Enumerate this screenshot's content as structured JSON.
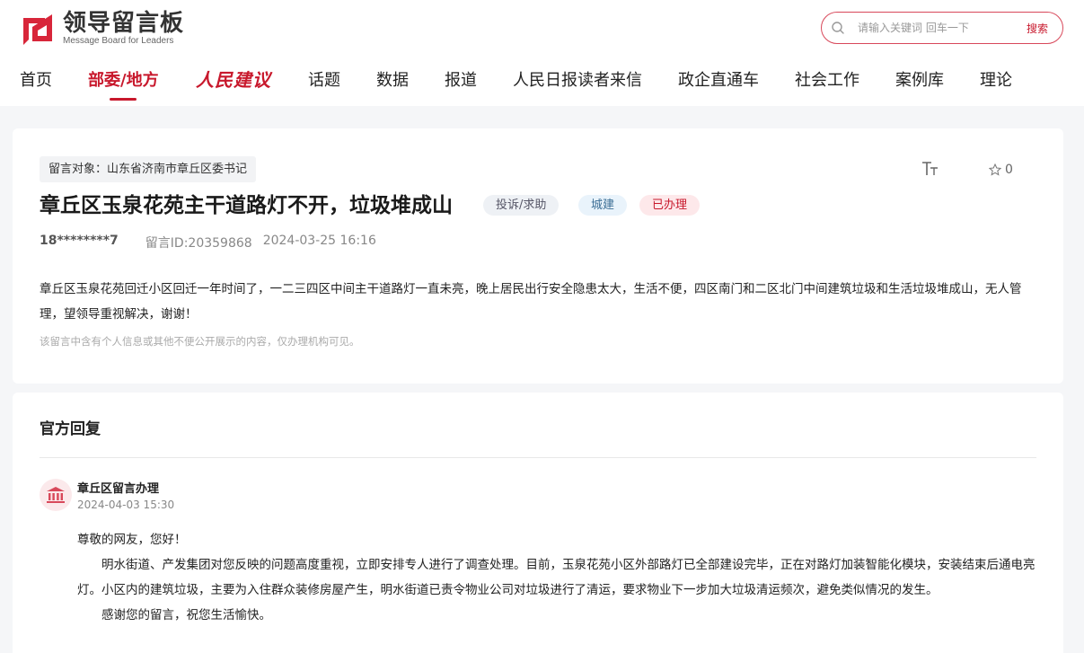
{
  "header": {
    "logo_cn": "领导留言板",
    "logo_en": "Message Board for Leaders",
    "search_placeholder": "请输入关键词 回车一下",
    "search_button": "搜索"
  },
  "nav": {
    "home": "首页",
    "ministries": "部委/地方",
    "brand": "人民建议",
    "topics": "话题",
    "data": "数据",
    "reports": "报道",
    "readers": "人民日报读者来信",
    "enterprise": "政企直通车",
    "social": "社会工作",
    "cases": "案例库",
    "theory": "理论"
  },
  "message": {
    "target": "留言对象：山东省济南市章丘区委书记",
    "title": "章丘区玉泉花苑主干道路灯不开，垃圾堆成山",
    "tag_type": "投诉/求助",
    "tag_field": "城建",
    "tag_status": "已办理",
    "star_count": "0",
    "user": "18********7",
    "message_id": "留言ID:20359868",
    "datetime": "2024-03-25 16:16",
    "content": "章丘区玉泉花苑回迁小区回迁一年时间了，一二三四区中间主干道路灯一直未亮，晚上居民出行安全隐患太大，生活不便，四区南门和二区北门中间建筑垃圾和生活垃圾堆成山，无人管理，望领导重视解决，谢谢！",
    "note": "该留言中含有个人信息或其他不便公开展示的内容，仅办理机构可见。"
  },
  "reply": {
    "header": "官方回复",
    "org": "章丘区留言办理",
    "time": "2024-04-03 15:30",
    "greeting": "尊敬的网友，您好！",
    "body": "明水街道、产发集团对您反映的问题高度重视，立即安排专人进行了调查处理。目前，玉泉花苑小区外部路灯已全部建设完毕，正在对路灯加装智能化模块，安装结束后通电亮灯。小区内的建筑垃圾，主要为入住群众装修房屋产生，明水街道已责令物业公司对垃圾进行了清运，要求物业下一步加大垃圾清运频次，避免类似情况的发生。",
    "closing": "感谢您的留言，祝您生活愉快。"
  },
  "colors": {
    "accent": "#c8182c",
    "page_bg": "#f5f6f8"
  }
}
